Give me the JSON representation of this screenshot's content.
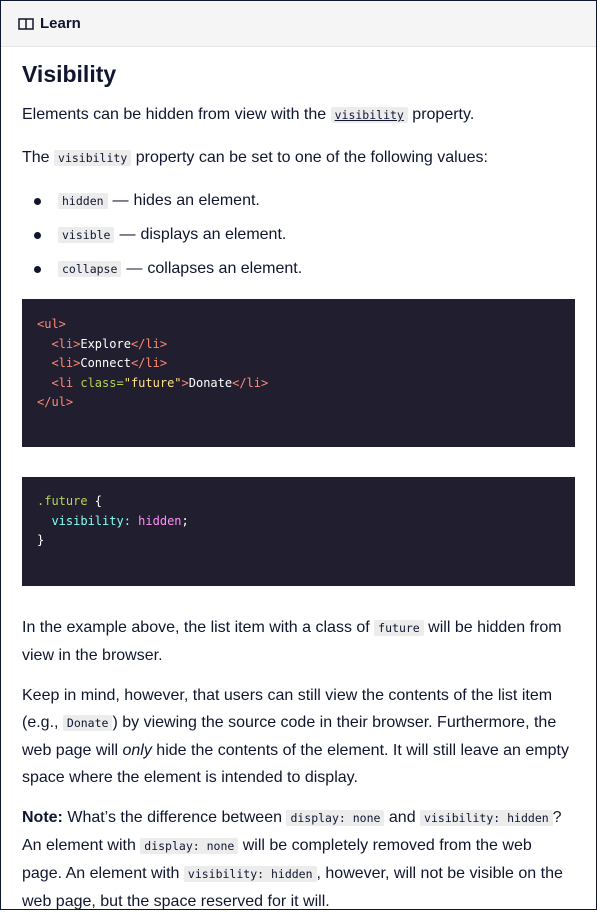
{
  "header": {
    "title": "Learn",
    "icon": "book-icon"
  },
  "heading": "Visibility",
  "intro": {
    "before": "Elements can be hidden from view with the ",
    "code": "visibility",
    "after": " property."
  },
  "values_intro": {
    "before": "The ",
    "code": "visibility",
    "after": " property can be set to one of the following values:"
  },
  "values": [
    {
      "code": "hidden",
      "text": "hides an element."
    },
    {
      "code": "visible",
      "text": "displays an element."
    },
    {
      "code": "collapse",
      "text": "collapses an element."
    }
  ],
  "dash": "—",
  "html_code": {
    "ul_open": "<ul>",
    "li_open": "<li>",
    "li_close": "</li>",
    "item1": "Explore",
    "item2": "Connect",
    "li_future_open": "<li ",
    "attr_name": "class=",
    "attr_value": "\"future\"",
    "tag_gt": ">",
    "item3": "Donate",
    "ul_close": "</ul>"
  },
  "css_code": {
    "selector": ".future",
    "open_brace": " {",
    "property": "visibility:",
    "value": "hidden",
    "semicolon": ";",
    "close_brace": "}"
  },
  "explain": {
    "before": "In the example above, the list item with a class of ",
    "code": "future",
    "after": " will be hidden from view in the browser."
  },
  "keep_in_mind": {
    "part1": "Keep in mind, however, that users can still view the contents of the list item (e.g., ",
    "code": "Donate",
    "part2": ") by viewing the source code in their browser. Furthermore, the web page will ",
    "em": "only",
    "part3": " hide the contents of the element. It will still leave an empty space where the element is intended to display."
  },
  "note": {
    "label": "Note:",
    "part1": " What’s the difference between ",
    "code1": "display: none",
    "part2": " and ",
    "code2": "visibility: hidden",
    "part3": "? An element with ",
    "code3": "display: none",
    "part4": " will be completely removed from the web page. An element with ",
    "code4": "visibility: hidden",
    "part5": ", however, will not be visible on the web page, but the space reserved for it will."
  }
}
